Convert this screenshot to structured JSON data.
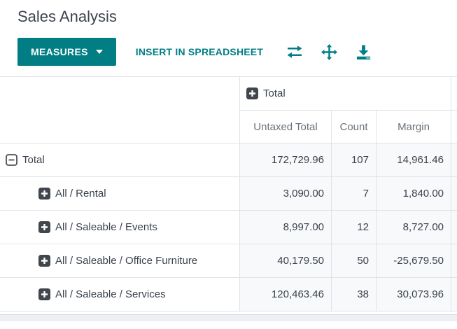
{
  "page": {
    "title": "Sales Analysis"
  },
  "toolbar": {
    "measures_label": "MEASURES",
    "insert_spreadsheet_label": "INSERT IN SPREADSHEET",
    "icons": [
      {
        "name": "flip-axes-icon"
      },
      {
        "name": "expand-full-icon"
      },
      {
        "name": "download-icon"
      }
    ]
  },
  "colors": {
    "accent_teal": "#017e84",
    "table_text": "#3b424c",
    "measure_header_text": "#6b727a",
    "value_cell_background": "#f8f9fb",
    "table_border": "#dfe3e8",
    "toggle_icon_dark": "#41464d",
    "bottom_strip_background": "#edeff4"
  },
  "pivot": {
    "column_group": {
      "label": "Total",
      "toggle": "plus"
    },
    "measures": [
      "Untaxed Total",
      "Count",
      "Margin"
    ],
    "rows": [
      {
        "label": "Total",
        "toggle": "minus",
        "indent": 0,
        "values": [
          "172,729.96",
          "107",
          "14,961.46"
        ]
      },
      {
        "label": "All / Rental",
        "toggle": "plus",
        "indent": 1,
        "values": [
          "3,090.00",
          "7",
          "1,840.00"
        ]
      },
      {
        "label": "All / Saleable / Events",
        "toggle": "plus",
        "indent": 1,
        "values": [
          "8,997.00",
          "12",
          "8,727.00"
        ]
      },
      {
        "label": "All / Saleable / Office Furniture",
        "toggle": "plus",
        "indent": 1,
        "values": [
          "40,179.50",
          "50",
          "-25,679.50"
        ]
      },
      {
        "label": "All / Saleable / Services",
        "toggle": "plus",
        "indent": 1,
        "values": [
          "120,463.46",
          "38",
          "30,073.96"
        ]
      }
    ]
  }
}
